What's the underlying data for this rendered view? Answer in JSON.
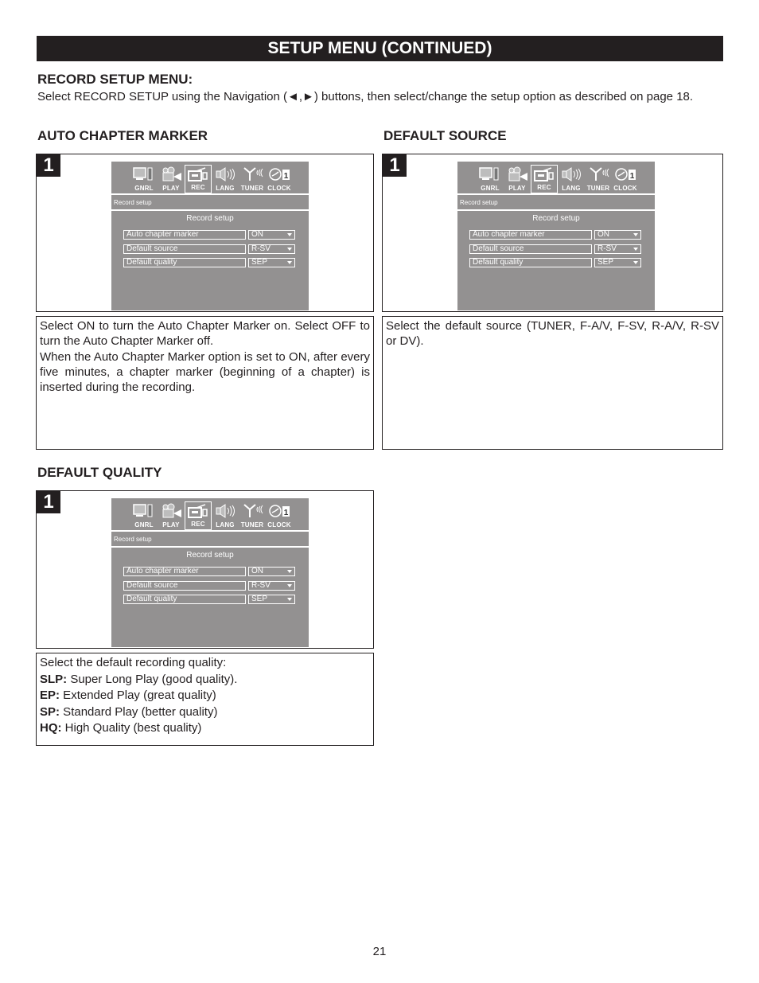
{
  "page": {
    "title": "SETUP MENU (CONTINUED)",
    "section_heading": "RECORD SETUP MENU:",
    "intro": "Select RECORD SETUP using the Navigation (◄,►) buttons, then select/change the setup option as described on page 18.",
    "page_number": "21"
  },
  "osd": {
    "tabs": [
      {
        "label": "GNRL",
        "icon": "tv-remote-icon",
        "active": false
      },
      {
        "label": "PLAY",
        "icon": "projector-icon",
        "active": false
      },
      {
        "label": "REC",
        "icon": "camcorder-icon",
        "active": true
      },
      {
        "label": "LANG",
        "icon": "speaker-icon",
        "active": false
      },
      {
        "label": "TUNER",
        "icon": "antenna-icon",
        "active": false
      },
      {
        "label": "CLOCK",
        "icon": "clock-icon",
        "active": false
      }
    ],
    "clock_badge": "1",
    "breadcrumb": "Record setup",
    "panel_title": "Record setup",
    "rows": [
      {
        "name": "Auto chapter marker",
        "value": "ON"
      },
      {
        "name": "Default source",
        "value": "R-SV"
      },
      {
        "name": "Default quality",
        "value": "SEP"
      }
    ]
  },
  "sections": {
    "auto_chapter": {
      "heading": "AUTO CHAPTER MARKER",
      "step": "1",
      "para1": "Select ON to turn the Auto Chapter Marker on. Select OFF to turn the  Auto Chapter Marker off.",
      "para2": "When the Auto Chapter Marker option is set to ON, after every five minutes, a chapter marker (beginning of a chapter) is inserted during the recording."
    },
    "default_source": {
      "heading": "DEFAULT SOURCE",
      "step": "1",
      "para1": "Select the default source (TUNER, F-A/V, F-SV, R-A/V, R-SV or DV)."
    },
    "default_quality": {
      "heading": "DEFAULT QUALITY",
      "step": "1",
      "intro": "Select the default recording quality:",
      "items": [
        {
          "term": "SLP:",
          "desc": " Super Long Play (good quality)."
        },
        {
          "term": "EP:",
          "desc": " Extended Play (great quality)"
        },
        {
          "term": "SP:",
          "desc": " Standard Play (better quality)"
        },
        {
          "term": "HQ:",
          "desc": " High Quality (best quality)"
        }
      ]
    }
  }
}
